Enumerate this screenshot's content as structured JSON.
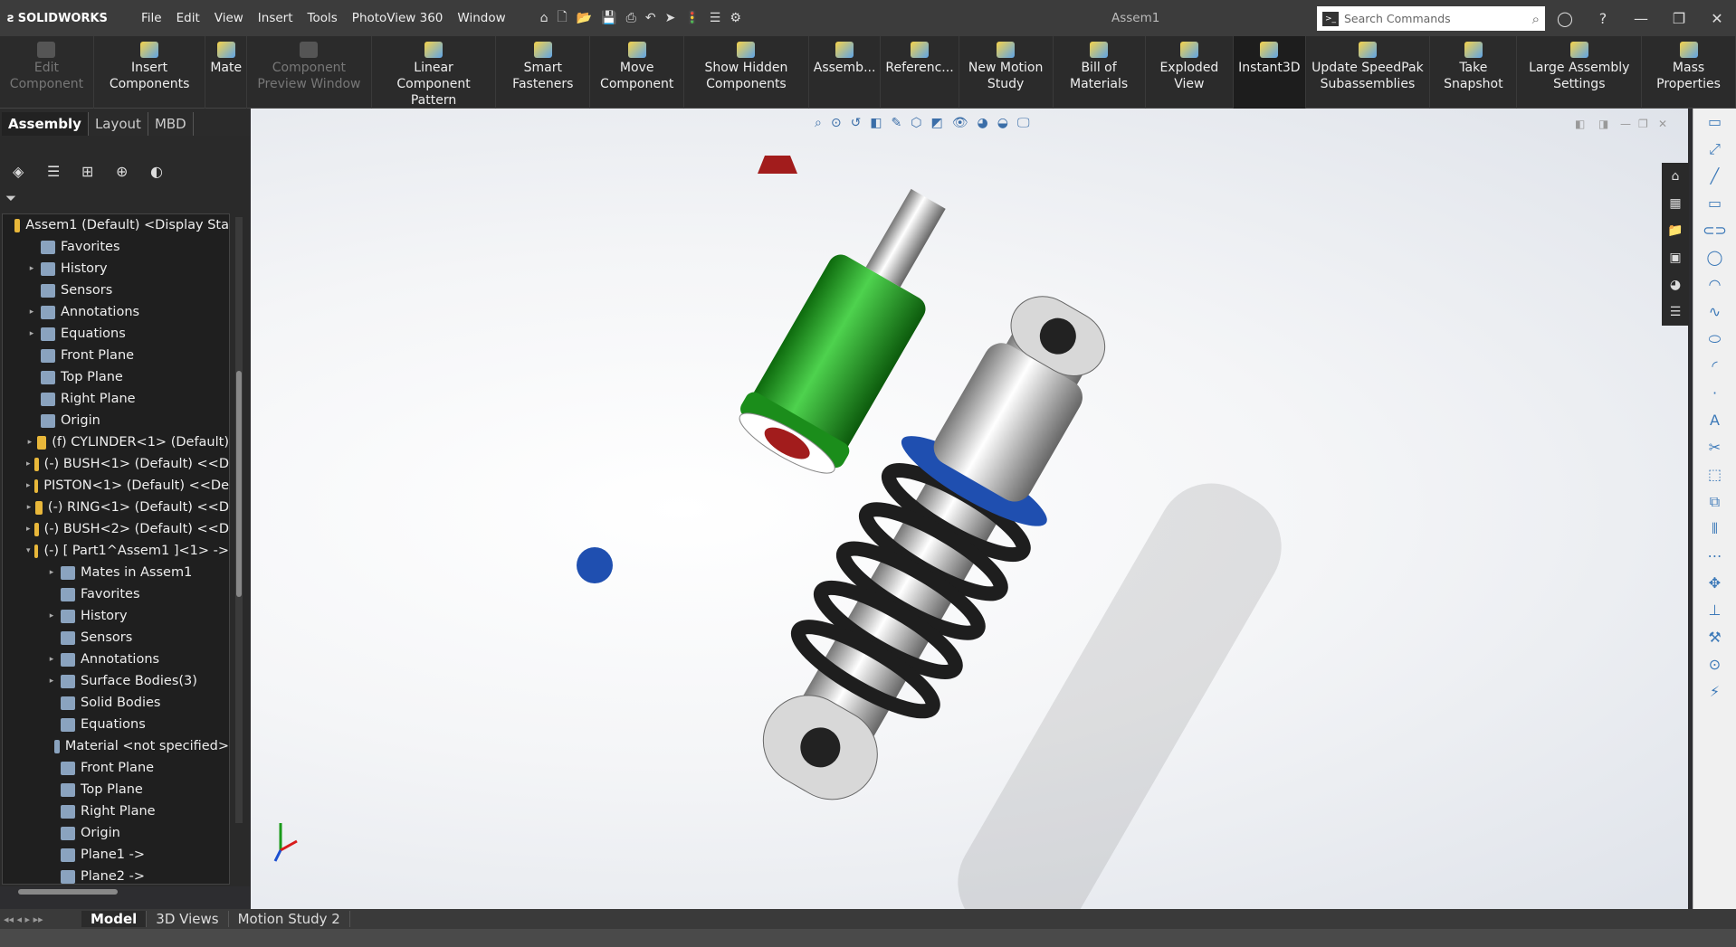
{
  "app": {
    "logo": "SOLIDWORKS",
    "doc_title": "Assem1"
  },
  "menu": [
    "File",
    "Edit",
    "View",
    "Insert",
    "Tools",
    "PhotoView 360",
    "Window"
  ],
  "search": {
    "placeholder": "Search Commands"
  },
  "commands": [
    {
      "label": "Edit Component",
      "disabled": true
    },
    {
      "label": "Insert Components"
    },
    {
      "label": "Mate"
    },
    {
      "label": "Component Preview Window",
      "disabled": true
    },
    {
      "label": "Linear Component Pattern"
    },
    {
      "label": "Smart Fasteners"
    },
    {
      "label": "Move Component"
    },
    {
      "label": "Show Hidden Components"
    },
    {
      "label": "Assemb..."
    },
    {
      "label": "Referenc..."
    },
    {
      "label": "New Motion Study"
    },
    {
      "label": "Bill of Materials"
    },
    {
      "label": "Exploded View"
    },
    {
      "label": "Instant3D",
      "active": true
    },
    {
      "label": "Update SpeedPak Subassemblies"
    },
    {
      "label": "Take Snapshot"
    },
    {
      "label": "Large Assembly Settings"
    },
    {
      "label": "Mass Properties"
    }
  ],
  "tabs": [
    "Assembly",
    "Layout",
    "MBD"
  ],
  "tree": [
    {
      "label": "Assem1 (Default) <Display Sta",
      "indent": 0,
      "arrow": "",
      "icon": "y"
    },
    {
      "label": "Favorites",
      "indent": 1,
      "arrow": ""
    },
    {
      "label": "History",
      "indent": 1,
      "arrow": "▸"
    },
    {
      "label": "Sensors",
      "indent": 1,
      "arrow": ""
    },
    {
      "label": "Annotations",
      "indent": 1,
      "arrow": "▸"
    },
    {
      "label": "Equations",
      "indent": 1,
      "arrow": "▸"
    },
    {
      "label": "Front Plane",
      "indent": 1,
      "arrow": ""
    },
    {
      "label": "Top Plane",
      "indent": 1,
      "arrow": ""
    },
    {
      "label": "Right Plane",
      "indent": 1,
      "arrow": ""
    },
    {
      "label": "Origin",
      "indent": 1,
      "arrow": ""
    },
    {
      "label": "(f) CYLINDER<1> (Default)",
      "indent": 1,
      "arrow": "▸",
      "icon": "y"
    },
    {
      "label": "(-) BUSH<1> (Default) <<D",
      "indent": 1,
      "arrow": "▸",
      "icon": "y"
    },
    {
      "label": "PISTON<1> (Default) <<De",
      "indent": 1,
      "arrow": "▸",
      "icon": "y"
    },
    {
      "label": "(-) RING<1> (Default) <<D",
      "indent": 1,
      "arrow": "▸",
      "icon": "y"
    },
    {
      "label": "(-) BUSH<2> (Default) <<D",
      "indent": 1,
      "arrow": "▸",
      "icon": "y"
    },
    {
      "label": "(-) [ Part1^Assem1 ]<1> ->",
      "indent": 1,
      "arrow": "▾",
      "icon": "y"
    },
    {
      "label": "Mates in Assem1",
      "indent": 2,
      "arrow": "▸"
    },
    {
      "label": "Favorites",
      "indent": 2,
      "arrow": ""
    },
    {
      "label": "History",
      "indent": 2,
      "arrow": "▸"
    },
    {
      "label": "Sensors",
      "indent": 2,
      "arrow": ""
    },
    {
      "label": "Annotations",
      "indent": 2,
      "arrow": "▸"
    },
    {
      "label": "Surface Bodies(3)",
      "indent": 2,
      "arrow": "▸"
    },
    {
      "label": "Solid Bodies",
      "indent": 2,
      "arrow": ""
    },
    {
      "label": "Equations",
      "indent": 2,
      "arrow": ""
    },
    {
      "label": "Material <not specified>",
      "indent": 2,
      "arrow": ""
    },
    {
      "label": "Front Plane",
      "indent": 2,
      "arrow": ""
    },
    {
      "label": "Top Plane",
      "indent": 2,
      "arrow": ""
    },
    {
      "label": "Right Plane",
      "indent": 2,
      "arrow": ""
    },
    {
      "label": "Origin",
      "indent": 2,
      "arrow": ""
    },
    {
      "label": "Plane1 ->",
      "indent": 2,
      "arrow": ""
    },
    {
      "label": "Plane2 ->",
      "indent": 2,
      "arrow": ""
    }
  ],
  "bottom_tabs": [
    "Model",
    "3D Views",
    "Motion Study 2"
  ],
  "colors": {
    "cylinder": "#22a124",
    "spring": "#1e1e1e",
    "ring": "#1f4fb0",
    "cap": "#a21c1c"
  }
}
